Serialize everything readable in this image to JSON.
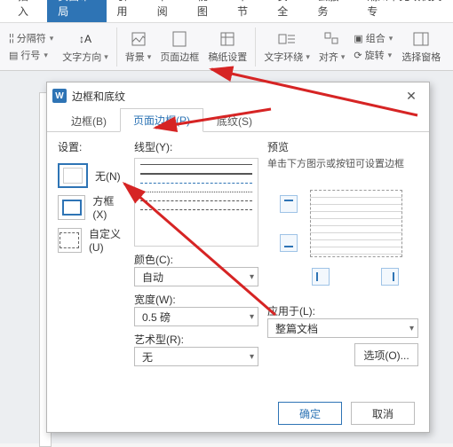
{
  "tabs": [
    "插入",
    "页面布局",
    "引用",
    "审阅",
    "视图",
    "章节",
    "安全",
    "云服务",
    "潮州市党政机关专"
  ],
  "active_tab_index": 1,
  "ribbon": {
    "small1": [
      "分隔符",
      "行号"
    ],
    "textdir": "文字方向",
    "bg": "背景",
    "pageborder": "页面边框",
    "papersetup": "稿纸设置",
    "textwrap": "文字环绕",
    "align": "对齐",
    "group": "组合",
    "rotate": "旋转",
    "selpane": "选择窗格"
  },
  "dialog": {
    "title": "边框和底纹",
    "tabs": [
      "边框(B)",
      "页面边框(P)",
      "底纹(S)"
    ],
    "active": 1,
    "settings_hdr": "设置:",
    "presets": [
      {
        "key": "none",
        "label": "无(N)"
      },
      {
        "key": "box",
        "label": "方框(X)"
      },
      {
        "key": "custom",
        "label": "自定义(U)"
      }
    ],
    "selected_preset": 0,
    "linetype_hdr": "线型(Y):",
    "color_hdr": "颜色(C):",
    "color_value": "自动",
    "width_hdr": "宽度(W):",
    "width_value": "0.5  磅",
    "art_hdr": "艺术型(R):",
    "art_value": "无",
    "preview_hdr": "预览",
    "preview_hint": "单击下方图示或按钮可设置边框",
    "apply_hdr": "应用于(L):",
    "apply_value": "整篇文档",
    "options_btn": "选项(O)...",
    "ok": "确定",
    "cancel": "取消"
  }
}
